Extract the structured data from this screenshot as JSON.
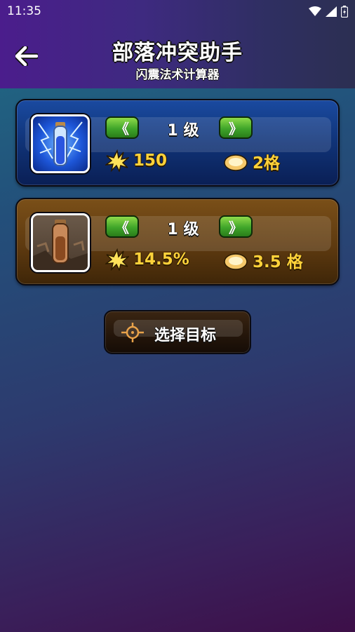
{
  "status_bar": {
    "time": "11:35"
  },
  "header": {
    "title": "部落冲突助手",
    "subtitle": "闪震法术计算器"
  },
  "spells": [
    {
      "name": "lightning",
      "level_label": "1 级",
      "prev": "《",
      "next": "》",
      "damage": "150",
      "radius": "2格"
    },
    {
      "name": "earthquake",
      "level_label": "1 级",
      "prev": "《",
      "next": "》",
      "damage": "14.5%",
      "radius": "3.5 格"
    }
  ],
  "select_target": {
    "label": "选择目标"
  },
  "colors": {
    "accent_gold": "#ffd23a",
    "button_green": "#3fa52a"
  }
}
